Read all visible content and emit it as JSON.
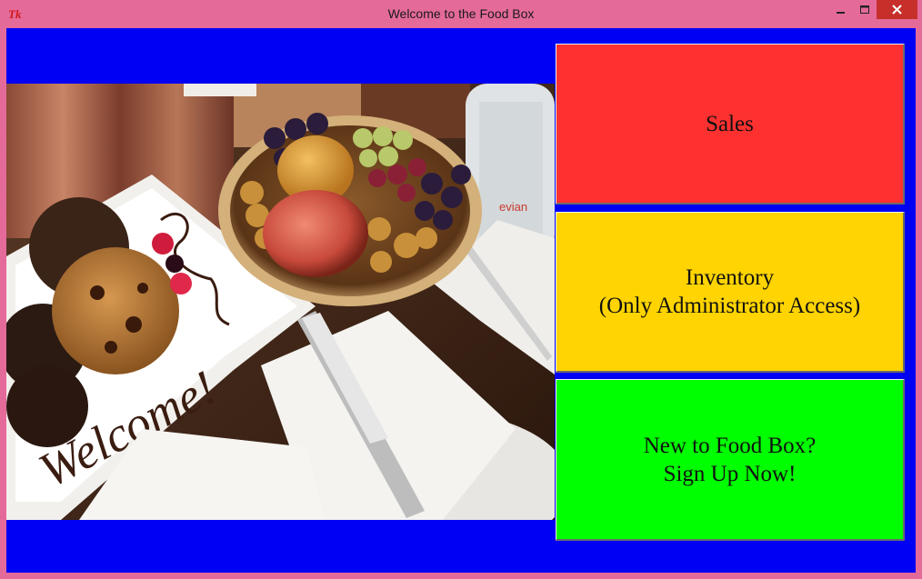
{
  "window": {
    "title": "Welcome to the Food Box"
  },
  "icons": {
    "app": "tk-feather-icon",
    "minimize": "minimize-icon",
    "maximize": "maximize-icon",
    "close": "close-icon"
  },
  "colors": {
    "window_frame": "#e46a9a",
    "background": "#0000f2",
    "sales_button": "#ff3030",
    "inventory_button": "#ffd400",
    "signup_button": "#00ff00",
    "close_button": "#c7302a"
  },
  "buttons": {
    "sales_label": "Sales",
    "inventory_label": "Inventory\n(Only Administrator Access)",
    "signup_label": "New to Food Box?\nSign Up Now!"
  },
  "photo": {
    "handwritten_text": "Welcome!",
    "bottle_label": "evian"
  }
}
